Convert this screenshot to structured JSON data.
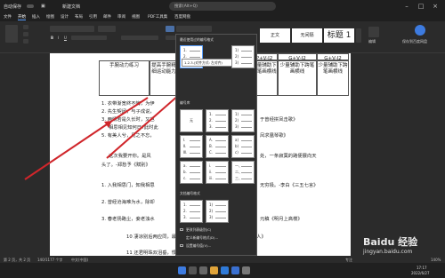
{
  "window": {
    "autosave": "自动保存",
    "doc_name": "新建文档",
    "search_placeholder": "搜索(Alt+Q)"
  },
  "ribbon_tabs": [
    "文件",
    "开始",
    "插入",
    "绘图",
    "设计",
    "布局",
    "引用",
    "邮件",
    "审阅",
    "视图",
    "PDF工具集",
    "百度网盘"
  ],
  "active_tab": "开始",
  "styles": [
    "正文",
    "无间隔",
    "标题 1"
  ],
  "ribbon_right": {
    "edit": "编辑",
    "baidu_save": "保存到百度网盘"
  },
  "table_cells": [
    [
      "手腕动力练习",
      "提高手腕精细运动能力",
      "P+V-I2",
      "G+V-I2",
      "G+V-I2"
    ],
    [
      "",
      "",
      "少量辅助下跨笔画横线",
      "少量辅助下跨笔画横线",
      "少量辅助下跨笔画横线"
    ],
    [
      "",
      "",
      "P+V-I2",
      "P+V-I2",
      "P+V-I2"
    ]
  ],
  "doc_lines": [
    {
      "num": "1.",
      "text": "衣带渐宽终不悔，为伊"
    },
    {
      "num": "2.",
      "text": "先生契阔，与子成说，"
    },
    {
      "num": "3.",
      "text": "两情若是久长时，又岂"
    },
    {
      "num": "",
      "text": "相思相见知何日?此时此"
    },
    {
      "num": "5.",
      "text": "有美人兮，见之不忘，"
    },
    {
      "num": "",
      "text": "这次我要开你。是风"
    },
    {
      "num": "",
      "text": "头了。-郑愁予《赋别》"
    },
    {
      "num": "1.",
      "text": "入我相思门，知我相思"
    },
    {
      "num": "2.",
      "text": "曾经沧海难为水，除却"
    },
    {
      "num": "3.",
      "text": "春老扬路尘，妾老浊水"
    }
  ],
  "doc_right_texts": [
    "于曾经拼凤击歌》",
    "凤求凰琴歌》",
    "处，一条寂寞的路便展向天",
    "无穷极。-李白《三五七言》",
    "元稹《明月上高楼》"
  ],
  "doc_lower": [
    "10 凄凉别后两应同，最是不胜清怨月明中。—纳兰性德《虞美人》",
    "11 还君明珠双泪垂，恨不相逢未嫁时。—张籍《节妇吟》"
  ],
  "dropdown": {
    "sec1": "最近使用过的编号格式",
    "sec2": "编号库",
    "sec3": "文档编号格式",
    "tooltip": "1.2.3.(对齐方式: 左对齐)",
    "none_label": "无",
    "menu": [
      "更改列表级别(C)",
      "定义新编号格式(D)...",
      "设置编号值(V)..."
    ]
  },
  "status": {
    "page": "第 2 页，共 2 页",
    "words": "140/1177 个字",
    "lang": "中文(中国)",
    "focus": "专注",
    "zoom": "140%"
  },
  "taskbar": {
    "time": "17:17",
    "date": "2022/6/27"
  },
  "watermark": {
    "brand": "Baidu 经验",
    "url": "jingyan.baidu.com"
  },
  "colors": {
    "arrow": "#d0262b",
    "accent": "#5aa0ff",
    "dark_bg": "#2b2b2b"
  }
}
